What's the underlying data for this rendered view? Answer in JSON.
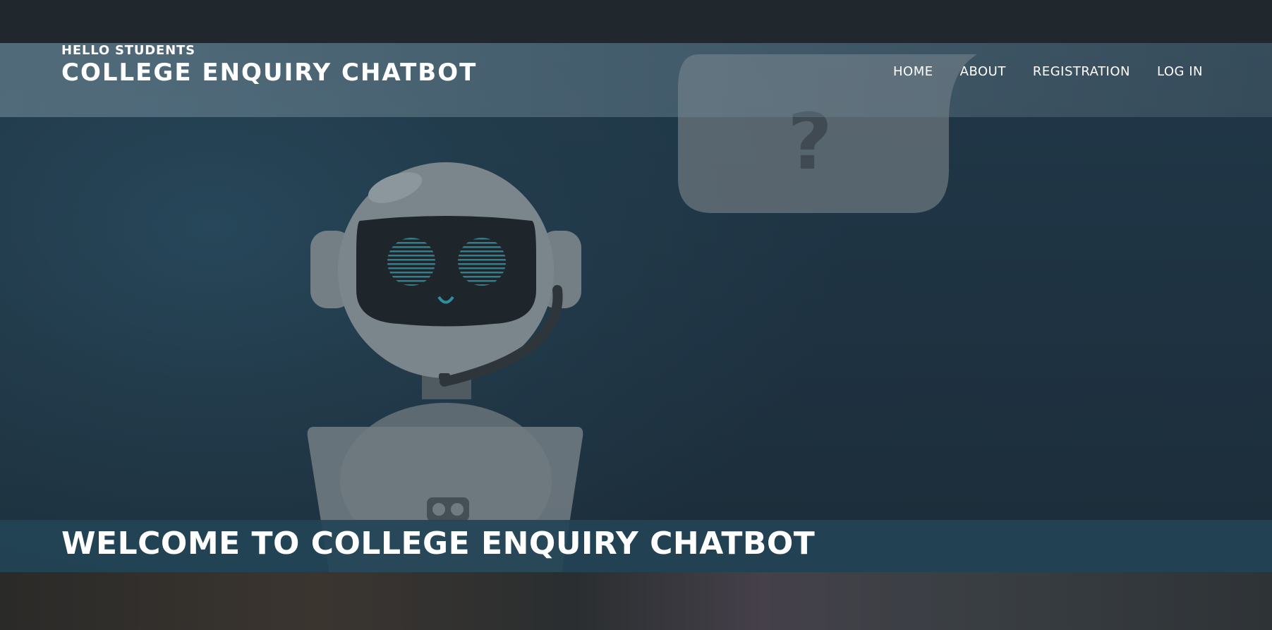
{
  "header": {
    "subtitle": "HELLO STUDENTS",
    "title": "COLLEGE ENQUIRY CHATBOT"
  },
  "nav": {
    "items": [
      {
        "label": "HOME"
      },
      {
        "label": "ABOUT"
      },
      {
        "label": "REGISTRATION"
      },
      {
        "label": "LOG IN"
      }
    ]
  },
  "hero": {
    "heading": "WELCOME TO COLLEGE ENQUIRY CHATBOT",
    "bubble_symbol": "?"
  },
  "icons": {
    "robot": "robot-illustration-icon",
    "speech_bubble": "speech-bubble-icon",
    "laptop": "laptop-icon"
  },
  "colors": {
    "header_bar": "#20282d",
    "hero_background": "#203848",
    "welcome_band": "#234456",
    "text": "#ffffff"
  }
}
